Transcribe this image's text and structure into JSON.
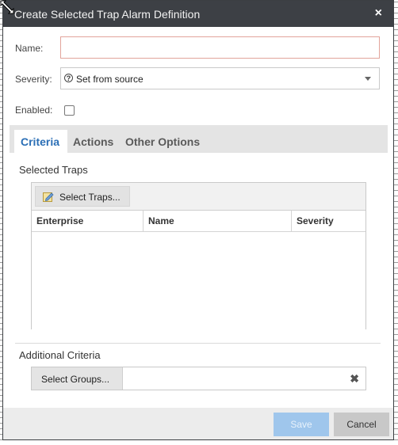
{
  "dialog": {
    "title": "Create Selected Trap Alarm Definition",
    "close_icon": "×"
  },
  "form": {
    "name_label": "Name:",
    "name_value": "",
    "severity_label": "Severity:",
    "severity_value": "Set from source",
    "enabled_label": "Enabled:",
    "enabled_checked": false
  },
  "tabs": [
    {
      "label": "Criteria",
      "active": true
    },
    {
      "label": "Actions",
      "active": false
    },
    {
      "label": "Other Options",
      "active": false
    }
  ],
  "criteria": {
    "selected_traps_label": "Selected Traps",
    "select_traps_button": "Select Traps...",
    "columns": [
      "Enterprise",
      "Name",
      "Severity"
    ],
    "rows": [],
    "additional_criteria_label": "Additional Criteria",
    "select_groups_button": "Select Groups..."
  },
  "footer": {
    "save_label": "Save",
    "cancel_label": "Cancel"
  },
  "colors": {
    "titlebar": "#3d4045",
    "active_tab": "#2b6fb6",
    "save_disabled": "#9fc6ec"
  }
}
